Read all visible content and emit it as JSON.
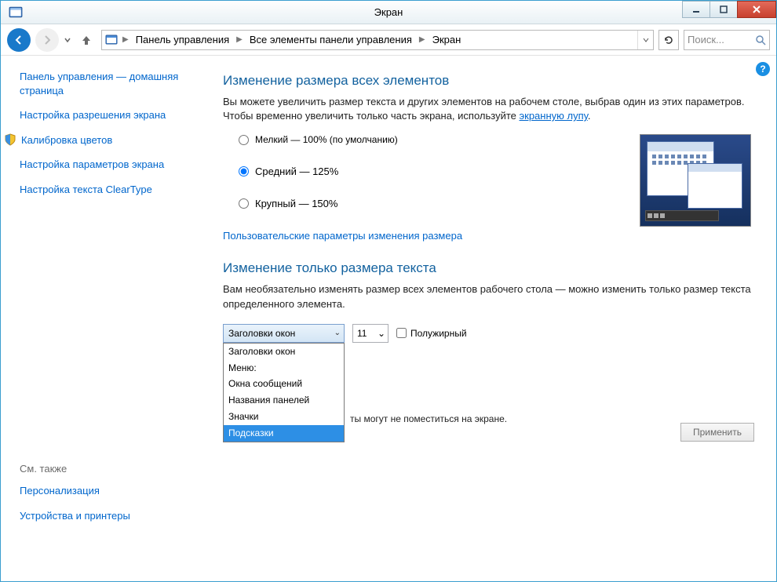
{
  "window": {
    "title": "Экран"
  },
  "breadcrumb": {
    "items": [
      "Панель управления",
      "Все элементы панели управления",
      "Экран"
    ]
  },
  "search": {
    "placeholder": "Поиск..."
  },
  "sidebar": {
    "home": "Панель управления — домашняя страница",
    "links": [
      "Настройка разрешения экрана",
      "Калибровка цветов",
      "Настройка параметров экрана",
      "Настройка текста ClearType"
    ],
    "also_title": "См. также",
    "also": [
      "Персонализация",
      "Устройства и принтеры"
    ]
  },
  "section1": {
    "title": "Изменение размера всех элементов",
    "desc_pre": "Вы можете увеличить размер текста и других элементов на рабочем столе, выбрав один из этих параметров. Чтобы временно увеличить только часть экрана, используйте ",
    "desc_link": "экранную лупу",
    "desc_post": ".",
    "radio_small": "Мелкий — 100% (по умолчанию)",
    "radio_medium": "Средний — 125%",
    "radio_large": "Крупный — 150%",
    "custom_link": "Пользовательские параметры изменения размера"
  },
  "section2": {
    "title": "Изменение только размера текста",
    "desc": "Вам необязательно изменять размер всех элементов рабочего стола — можно изменить только размер текста определенного элемента.",
    "combo_selected": "Заголовки окон",
    "combo_options": [
      "Заголовки окон",
      "Меню:",
      "Окна сообщений",
      "Названия панелей",
      "Значки",
      "Подсказки"
    ],
    "combo_highlighted_index": 5,
    "font_size": "11",
    "bold_label": "Полужирный",
    "note_partial": "ты могут не поместиться на экране.",
    "apply": "Применить"
  }
}
